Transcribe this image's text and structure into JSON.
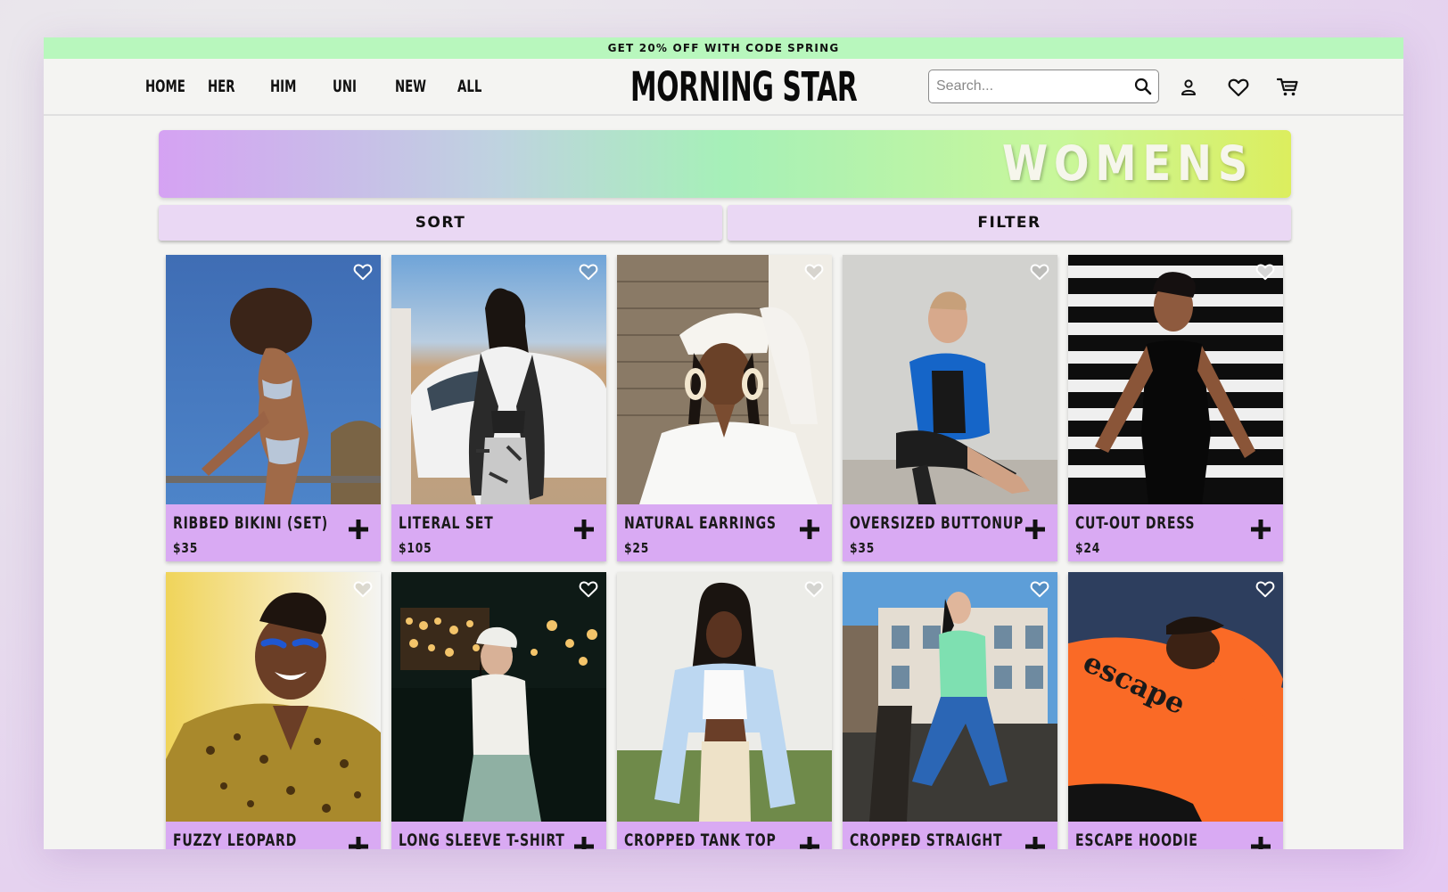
{
  "promo": {
    "text": "GET 20% OFF WITH CODE",
    "code": "SPRING"
  },
  "nav": [
    "HOME",
    "HER",
    "HIM",
    "UNI",
    "NEW",
    "ALL"
  ],
  "logo": "MORNING STAR",
  "search": {
    "placeholder": "Search..."
  },
  "banner": {
    "title": "WOMENS"
  },
  "controls": {
    "sort": "SORT",
    "filter": "FILTER"
  },
  "products": [
    {
      "name": "RIBBED BIKINI (SET)",
      "price": "$35"
    },
    {
      "name": "LITERAL SET",
      "price": "$105"
    },
    {
      "name": "NATURAL EARRINGS",
      "price": "$25"
    },
    {
      "name": "OVERSIZED BUTTONUP",
      "price": "$35"
    },
    {
      "name": "CUT-OUT DRESS",
      "price": "$24"
    },
    {
      "name": "FUZZY LEOPARD",
      "price": ""
    },
    {
      "name": "LONG SLEEVE T-SHIRT",
      "price": ""
    },
    {
      "name": "CROPPED TANK TOP",
      "price": ""
    },
    {
      "name": "CROPPED STRAIGHT",
      "price": ""
    },
    {
      "name": "ESCAPE HOODIE",
      "price": ""
    }
  ],
  "colors": {
    "promo_bg": "#b8f7bd",
    "card_bg": "#d9aaf3",
    "button_bg": "#ead8f4"
  }
}
